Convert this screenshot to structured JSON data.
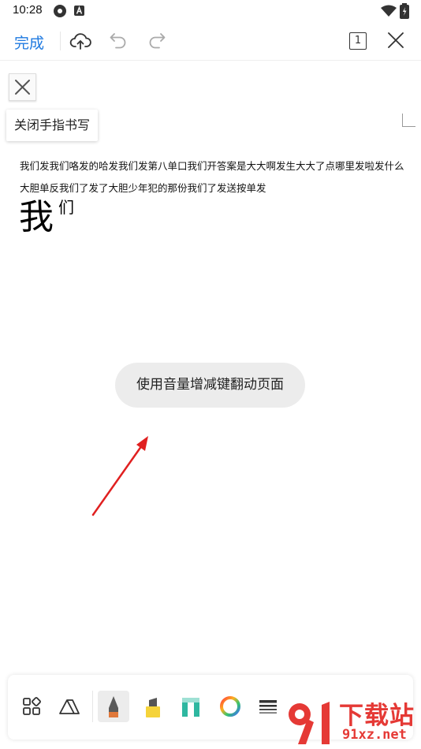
{
  "status_bar": {
    "time": "10:28"
  },
  "toolbar": {
    "done_label": "完成"
  },
  "page_indicator": "1",
  "handwriting": {
    "close_label": "关闭手指书写"
  },
  "document": {
    "lines": [
      "我们发我们咯发的哈发我们发第八单口我们开答案是大大啊发生大大了点哪里发啦发什么",
      "大胆单反我们了发了大胆少年犯的那份我们了发送按单发"
    ],
    "handwritten_big": "我",
    "handwritten_small": "们"
  },
  "toast": {
    "text": "使用音量增减键翻动页面"
  },
  "bottom_tools": {
    "pen_color": "#e0783a",
    "highlighter_color": "#f5d33a",
    "marker_color": "#2eb7a0"
  },
  "watermark": {
    "brand": "下载站",
    "url": "91xz.net"
  },
  "colors": {
    "accent": "#1f7ae0",
    "arrow": "#e02020"
  }
}
